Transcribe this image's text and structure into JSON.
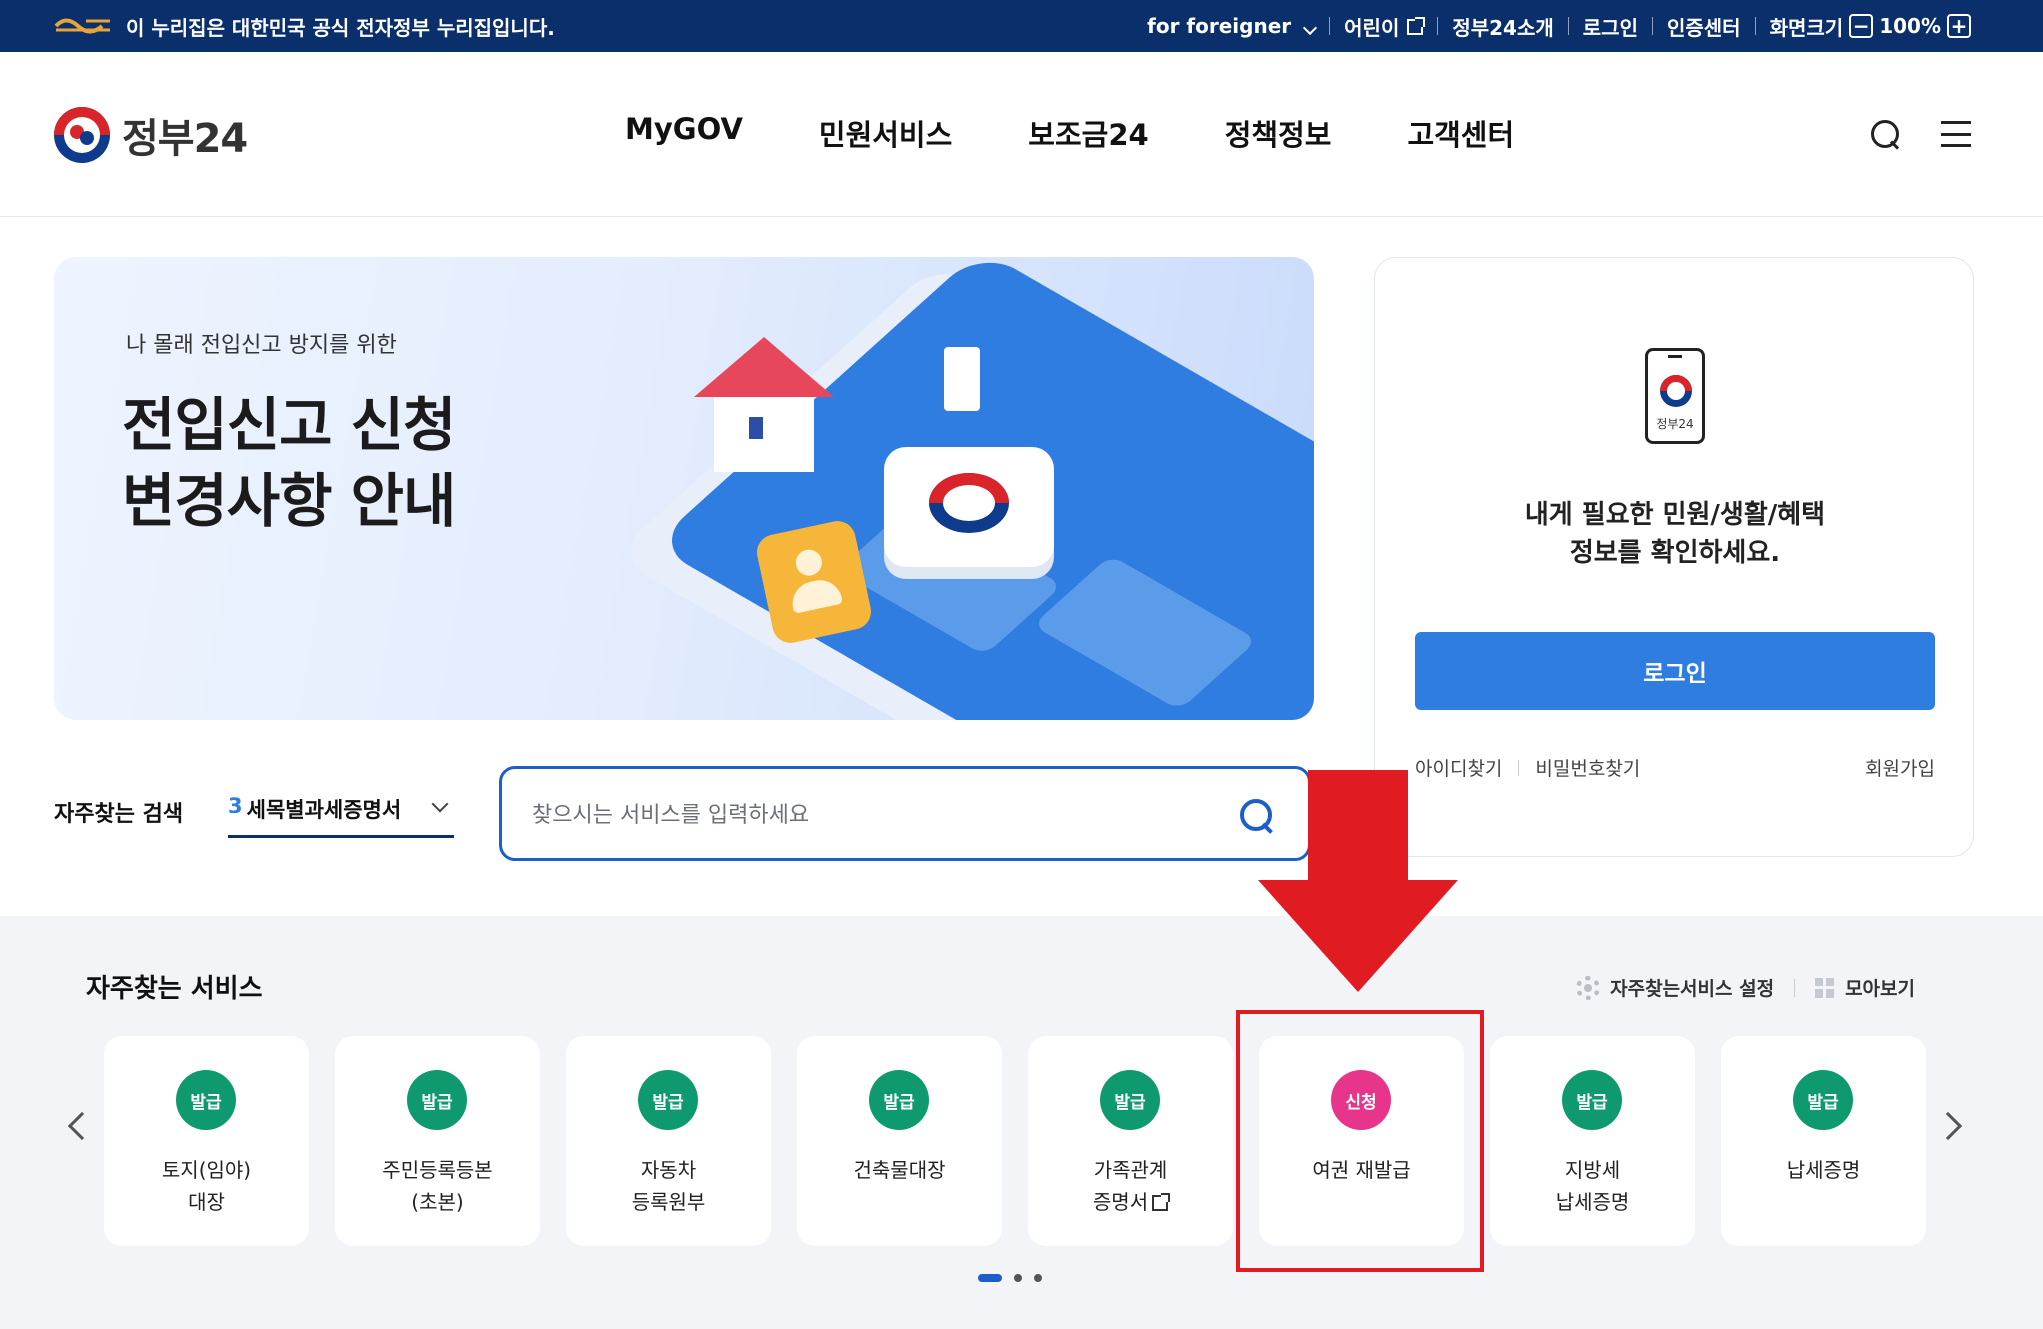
{
  "topbar": {
    "notice": "이 누리집은 대한민국 공식 전자정부 누리집입니다.",
    "foreigner": "for foreigner",
    "kids": "어린이",
    "about": "정부24소개",
    "login": "로그인",
    "cert": "인증센터",
    "screen_size": "화면크기",
    "zoom_minus": "−",
    "zoom": "100%",
    "zoom_plus": "+"
  },
  "header": {
    "brand": "정부24",
    "nav": [
      "MyGOV",
      "민원서비스",
      "보조금24",
      "정책정보",
      "고객센터"
    ]
  },
  "hero": {
    "sub": "나 몰래 전입신고 방지를 위한",
    "title_line1": "전입신고 신청",
    "title_line2": "변경사항 안내"
  },
  "login_box": {
    "app_label": "정부24",
    "message_line1": "내게 필요한 민원/생활/혜택",
    "message_line2": "정보를 확인하세요.",
    "login_button": "로그인",
    "find_id": "아이디찾기",
    "find_pw": "비밀번호찾기",
    "signup": "회원가입"
  },
  "search": {
    "label": "자주찾는 검색",
    "rank": "3",
    "keyword": "세목별과세증명서",
    "placeholder": "찾으시는 서비스를 입력하세요"
  },
  "services": {
    "title": "자주찾는 서비스",
    "settings": "자주찾는서비스 설정",
    "view_all": "모아보기",
    "items": [
      {
        "badge": "발급",
        "name": "토지(임야)\n대장",
        "badge_color": "#0e9a6e"
      },
      {
        "badge": "발급",
        "name": "주민등록등본\n(초본)",
        "badge_color": "#0e9a6e"
      },
      {
        "badge": "발급",
        "name": "자동차\n등록원부",
        "badge_color": "#0e9a6e"
      },
      {
        "badge": "발급",
        "name": "건축물대장",
        "badge_color": "#0e9a6e"
      },
      {
        "badge": "발급",
        "name": "가족관계\n증명서",
        "badge_color": "#0e9a6e"
      },
      {
        "badge": "신청",
        "name": "여권 재발급",
        "badge_color": "#e6358a"
      },
      {
        "badge": "발급",
        "name": "지방세\n납세증명",
        "badge_color": "#0e9a6e"
      },
      {
        "badge": "발급",
        "name": "납세증명",
        "badge_color": "#0e9a6e"
      }
    ]
  },
  "colors": {
    "topbar": "#0b2f6b",
    "primary": "#2f7de1",
    "annotation_red": "#e01b22"
  }
}
